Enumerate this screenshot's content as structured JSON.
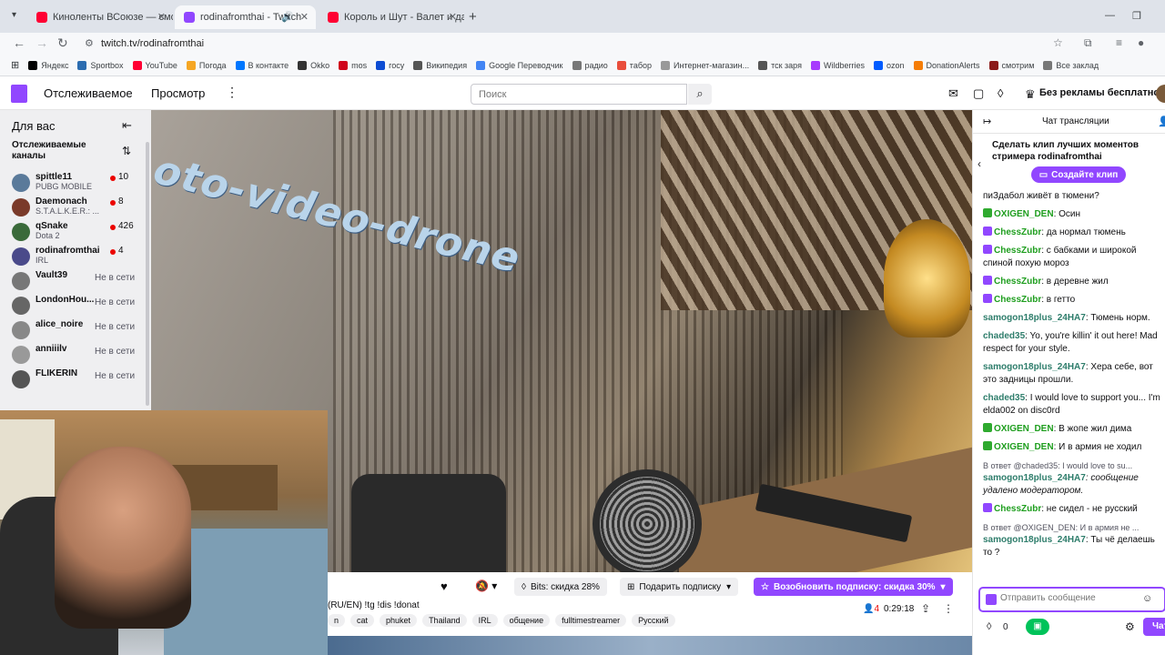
{
  "browser": {
    "tabs": [
      {
        "title": "Киноленты ВСоюзе — смотре",
        "color": "#ff0033"
      },
      {
        "title": "rodinafromthai - Twitch",
        "color": "#9147ff"
      },
      {
        "title": "Король и Шут - Валет и дама",
        "color": "#ff0033"
      }
    ],
    "url": "twitch.tv/rodinafromthai",
    "bookmarks": [
      {
        "label": "Яндекс",
        "color": "#000000"
      },
      {
        "label": "Sportbox",
        "color": "#2b6cb0"
      },
      {
        "label": "YouTube",
        "color": "#ff0033"
      },
      {
        "label": "Погода",
        "color": "#f5a623"
      },
      {
        "label": "В контакте",
        "color": "#0077ff"
      },
      {
        "label": "Okko",
        "color": "#333333"
      },
      {
        "label": "mos",
        "color": "#d0021b"
      },
      {
        "label": "госу",
        "color": "#0d4cd3"
      },
      {
        "label": "Википедия",
        "color": "#555555"
      },
      {
        "label": "Google Переводчик",
        "color": "#4285f4"
      },
      {
        "label": "радио",
        "color": "#777777"
      },
      {
        "label": "табор",
        "color": "#e94e3c"
      },
      {
        "label": "Интернет-магазин...",
        "color": "#999999"
      },
      {
        "label": "тск заря",
        "color": "#555555"
      },
      {
        "label": "Wildberries",
        "color": "#a73afd"
      },
      {
        "label": "ozon",
        "color": "#005bff"
      },
      {
        "label": "DonationAlerts",
        "color": "#f57d07"
      },
      {
        "label": "смотрим",
        "color": "#8b1a1a"
      },
      {
        "label": "Все заклад",
        "color": "#777777"
      }
    ]
  },
  "nav": {
    "following": "Отслеживаемое",
    "browse": "Просмотр",
    "search_placeholder": "Поиск",
    "no_ads": "Без рекламы бесплатно"
  },
  "sidebar": {
    "title": "Для вас",
    "subtitle": "Отслеживаемые каналы",
    "channels": [
      {
        "name": "spittle11",
        "game": "PUBG MOBILE",
        "viewers": "10",
        "live": true,
        "color": "#5a7a9a"
      },
      {
        "name": "Daemonach",
        "game": "S.T.A.L.K.E.R.: ...",
        "viewers": "8",
        "live": true,
        "color": "#7a3a2a"
      },
      {
        "name": "qSnake",
        "game": "Dota 2",
        "viewers": "426",
        "live": true,
        "color": "#3a6a3a"
      },
      {
        "name": "rodinafromthai",
        "game": "IRL",
        "viewers": "4",
        "live": true,
        "color": "#4a4a8a"
      },
      {
        "name": "Vault39",
        "status": "Не в сети",
        "live": false,
        "color": "#777777"
      },
      {
        "name": "LondonHou...",
        "status": "Не в сети",
        "live": false,
        "color": "#666666"
      },
      {
        "name": "alice_noire",
        "status": "Не в сети",
        "live": false,
        "color": "#888888"
      },
      {
        "name": "anniiilv",
        "status": "Не в сети",
        "live": false,
        "color": "#999999"
      },
      {
        "name": "FLIKERIN",
        "status": "Не в сети",
        "live": false,
        "color": "#555555"
      }
    ]
  },
  "video": {
    "watermark": "oto-video-drone"
  },
  "player_bar": {
    "bits_label": "Bits: скидка 28%",
    "gift_label": "Подарить подписку",
    "renew_label": "Возобновить подписку: скидка 30%",
    "description": "(RU/EN) !tg !dis !donat",
    "tags": [
      "n",
      "cat",
      "phuket",
      "Thailand",
      "IRL",
      "общение",
      "fulltimestreamer",
      "Русский"
    ],
    "viewers": "4",
    "uptime": "0:29:18"
  },
  "chat": {
    "title": "Чат трансляции",
    "clip_prompt": "Сделать клип лучших моментов стримера rodinafromthai",
    "clip_button": "Создайте клип",
    "input_placeholder": "Отправить сообщение",
    "bits_count": "0",
    "chat_button": "Чат",
    "messages": [
      {
        "user": "",
        "text": "пиЗдабол живёт в тюмени?",
        "color": "#0e0e10"
      },
      {
        "user": "OXIGEN_DEN",
        "text": ": Осин",
        "color": "#1e9e1e",
        "badge": "#2faa2f"
      },
      {
        "user": "ChessZubr",
        "text": ": да нормал тюмень",
        "color": "#1e9e1e",
        "badge": "#9147ff"
      },
      {
        "user": "ChessZubr",
        "text": ": с бабками и широкой спиной похую мороз",
        "color": "#1e9e1e",
        "badge": "#9147ff"
      },
      {
        "user": "ChessZubr",
        "text": ": в деревне жил",
        "color": "#1e9e1e",
        "badge": "#9147ff"
      },
      {
        "user": "ChessZubr",
        "text": ": в гетто",
        "color": "#1e9e1e",
        "badge": "#9147ff"
      },
      {
        "user": "samogon18plus_24HA7",
        "text": ": Тюмень норм.",
        "color": "#2e7d6b"
      },
      {
        "user": "chaded35",
        "text": ": Yo, you're killin' it out here! Mad respect for your style.",
        "color": "#2e7d6b"
      },
      {
        "user": "samogon18plus_24HA7",
        "text": ": Хера себе, вот это задницы прошли.",
        "color": "#2e7d6b"
      },
      {
        "user": "chaded35",
        "text": ": I would love to support you... I'm elda002 on disc0rd",
        "color": "#2e7d6b"
      },
      {
        "user": "OXIGEN_DEN",
        "text": ": В жопе жил дима",
        "color": "#1e9e1e",
        "badge": "#2faa2f"
      },
      {
        "user": "OXIGEN_DEN",
        "text": ": И в армия не ходил",
        "color": "#1e9e1e",
        "badge": "#2faa2f"
      },
      {
        "reply": "В ответ @chaded35: I would love to su...",
        "user": "samogon18plus_24HA7",
        "text": ": сообщение удалено модератором.",
        "color": "#2e7d6b",
        "italic": true
      },
      {
        "user": "ChessZubr",
        "text": ": не сидел - не русский",
        "color": "#1e9e1e",
        "badge": "#9147ff"
      },
      {
        "reply": "В ответ @OXIGEN_DEN: И в армия не ...",
        "user": "samogon18plus_24HA7",
        "text": ": Ты чё делаешь то ?",
        "color": "#2e7d6b"
      }
    ]
  }
}
